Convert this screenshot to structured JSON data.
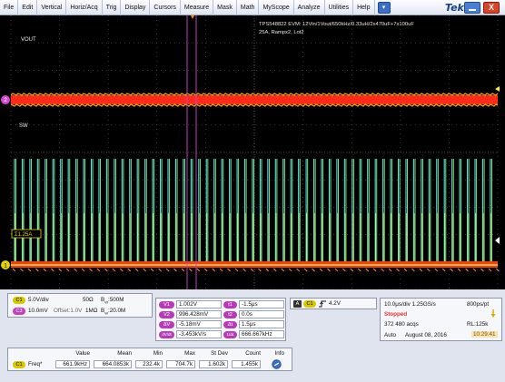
{
  "menu": {
    "items": [
      "File",
      "Edit",
      "Vertical",
      "Horiz/Acq",
      "Trig",
      "Display",
      "Cursors",
      "Measure",
      "Mask",
      "Math",
      "MyScope",
      "Analyze",
      "Utilities",
      "Help"
    ],
    "dropdown_glyph": "▾"
  },
  "brand": "Tek",
  "window_controls": {
    "close_glyph": "X"
  },
  "scope": {
    "annotation_line1": "TPS548822 EVM: 12Vin/1Vout/650kHz/0.33uH/2x470uF+7x100uF",
    "annotation_line2": "25A, Rampx2, Lot2",
    "waveform_labels": {
      "vout": "VOUT",
      "sw": "SW"
    },
    "ch1_marker": "1",
    "ch2_marker": "2",
    "ref_marker": "Σ1.25A",
    "colors": {
      "ch1": "#ffe94a",
      "ch2": "#4fe6e0",
      "ch3": "#ff2020",
      "cursor": "#c040c0",
      "grid": "#555555"
    }
  },
  "channels": [
    {
      "id": "C1",
      "scale": "5.0V/div",
      "impedance": "50Ω",
      "bw": "B",
      "bw_sub": "W",
      "bw_value": ":500M",
      "color": "#d9c800"
    },
    {
      "id": "C3",
      "scale": "10.0mV",
      "offset": "Offset:1.0V",
      "impedance": "1MΩ",
      "bw": "B",
      "bw_sub": "W",
      "bw_value": ":20.0M",
      "color": "#c040c0"
    }
  ],
  "cursors": [
    {
      "badge": "V1",
      "value": "1.002V",
      "badge2": "t1",
      "value2": "-1.5μs"
    },
    {
      "badge": "V2",
      "value": "996.428mV",
      "badge2": "t2",
      "value2": "0.0s"
    },
    {
      "badge": "ΔV",
      "value": "-5.18mV",
      "badge2": "Δt",
      "value2": "1.5μs"
    },
    {
      "badge": "dV/dt",
      "value": "-3.453kV/s",
      "badge2": "1/Δt",
      "value2": "666.667kHz"
    }
  ],
  "trigger": {
    "mode": "A",
    "source": "C1",
    "slope_icon": "rising-edge",
    "level": "4.2V"
  },
  "horizontal": {
    "timebase": "10.0μs/div  1.25GS/s",
    "resolution": "800ps/pt",
    "state": "Stopped",
    "acqs": "372 480 acqs",
    "record_length": "RL:125k",
    "mode": "Auto",
    "date": "August 08, 2016",
    "time": "10:29:41"
  },
  "measurement": {
    "headers": [
      "Value",
      "Mean",
      "Min",
      "Max",
      "St Dev",
      "Count",
      "Info"
    ],
    "rows": [
      {
        "source": "C1",
        "name": "Freq*",
        "values": [
          "661.9kHz",
          "664.0853k",
          "232.4k",
          "704.7k",
          "1.602k",
          "1.455k"
        ]
      }
    ]
  }
}
